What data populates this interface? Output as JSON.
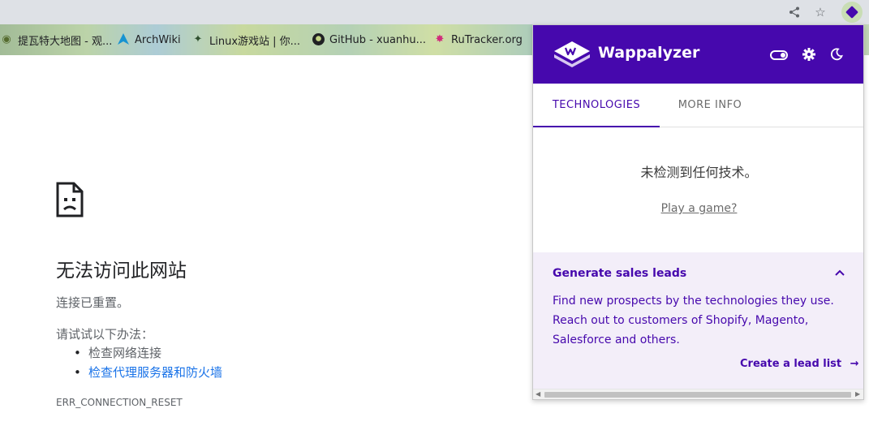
{
  "toolbar": {
    "share_icon": "share-icon",
    "star_icon": "star-icon",
    "extension_icon": "wappalyzer-extension-icon"
  },
  "bookmarks": [
    {
      "label": "提瓦特大地图 - 观...",
      "icon": "map-icon"
    },
    {
      "label": "ArchWiki",
      "icon": "arch-icon"
    },
    {
      "label": "Linux游戏站 | 你...",
      "icon": "linux-icon"
    },
    {
      "label": "GitHub - xuanhu...",
      "icon": "github-icon"
    },
    {
      "label": "RuTracker.org",
      "icon": "rutracker-icon"
    }
  ],
  "error_page": {
    "title": "无法访问此网站",
    "subtitle": "连接已重置。",
    "try_label": "请试试以下办法：",
    "suggestions": [
      "检查网络连接",
      "检查代理服务器和防火墙"
    ],
    "error_code": "ERR_CONNECTION_RESET"
  },
  "popup": {
    "brand": "Wappalyzer",
    "tabs": [
      "TECHNOLOGIES",
      "MORE INFO"
    ],
    "active_tab": "TECHNOLOGIES",
    "no_tech_message": "未检测到任何技术。",
    "play_link": "Play a game?",
    "leads": {
      "title": "Generate sales leads",
      "text": "Find new prospects by the technologies they use. Reach out to customers of Shopify, Magento, Salesforce and others.",
      "button": "Create a lead list"
    }
  },
  "colors": {
    "brand_purple": "#4608ad",
    "leads_bg": "#f3eef9",
    "link_blue": "#1a73e8"
  }
}
